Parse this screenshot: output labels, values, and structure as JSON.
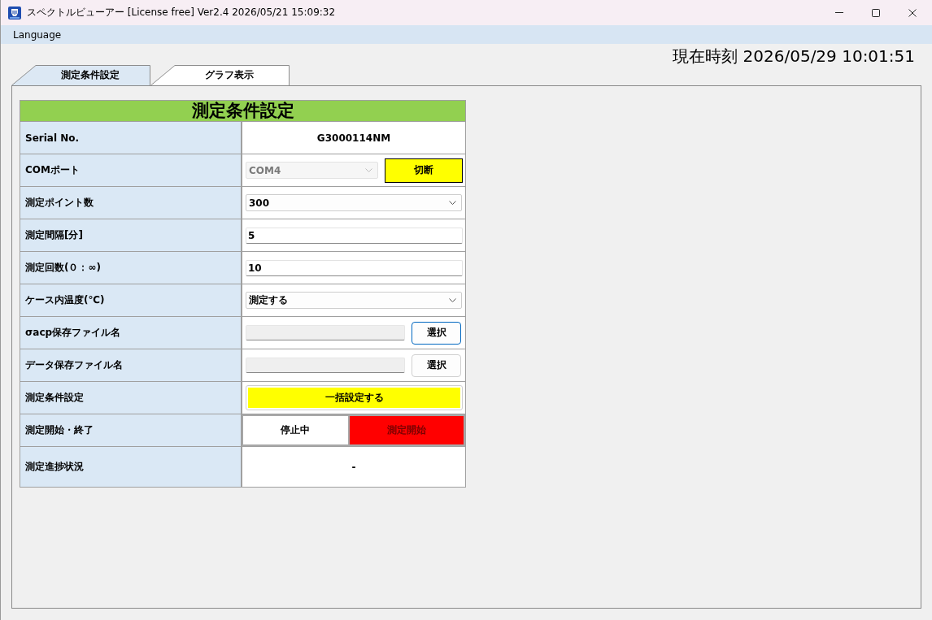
{
  "window": {
    "title": "スペクトルビューアー [License free] Ver2.4 2026/05/21 15:09:32"
  },
  "menu": [
    {
      "label": "Language"
    }
  ],
  "clock": "現在時刻 2026/05/29 10:01:51",
  "tabs": [
    {
      "label": "測定条件設定",
      "selected": true
    },
    {
      "label": "グラフ表示",
      "selected": false
    }
  ],
  "panel": {
    "heading": "測定条件設定",
    "rows": [
      {
        "kind": "text",
        "label": "Serial No.",
        "value": "G3000114NM"
      },
      {
        "kind": "select_button",
        "label": "COMポート",
        "value": "COM4",
        "disabled": true,
        "button": "切断"
      },
      {
        "kind": "select",
        "label": "測定ポイント数",
        "value": "300",
        "disabled": false
      },
      {
        "kind": "input",
        "label": "測定間隔[分]",
        "value": "5"
      },
      {
        "kind": "input",
        "label": "測定回数(０：∞)",
        "value": "10"
      },
      {
        "kind": "select",
        "label": "ケース内温度(℃)",
        "value": "測定する",
        "disabled": false
      },
      {
        "kind": "file",
        "label": "σacp保存ファイル名",
        "button": "選択",
        "focused": true
      },
      {
        "kind": "file",
        "label": "データ保存ファイル名",
        "button": "選択",
        "focused": false
      },
      {
        "kind": "action",
        "label": "測定条件設定",
        "button": "一括設定する"
      },
      {
        "kind": "toggle",
        "label": "測定開始・終了",
        "status": "停止中",
        "button": "測定開始"
      },
      {
        "kind": "text",
        "label": "測定進捗状況",
        "value": "-"
      }
    ]
  }
}
